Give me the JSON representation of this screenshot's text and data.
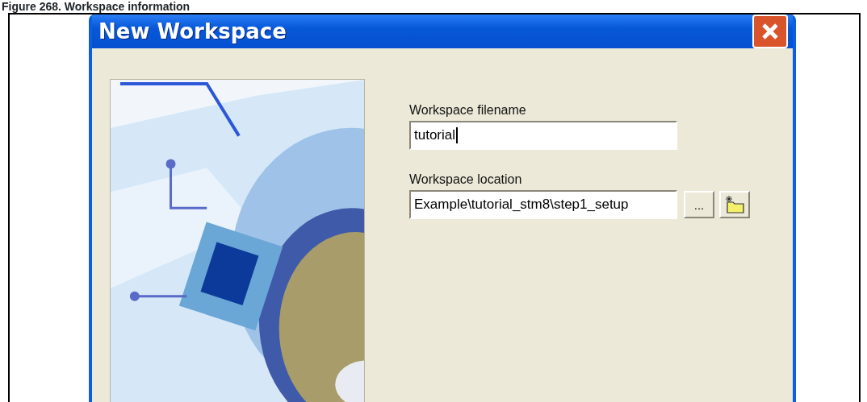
{
  "caption": "Figure 268. Workspace information",
  "window": {
    "title": "New Workspace"
  },
  "fields": [
    {
      "label": "Workspace filename",
      "value": "tutorial",
      "focused": true
    },
    {
      "label": "Workspace location",
      "value": "Example\\tutorial_stm8\\step1_setup",
      "focused": false
    }
  ],
  "browse_button": {
    "label": "..."
  }
}
